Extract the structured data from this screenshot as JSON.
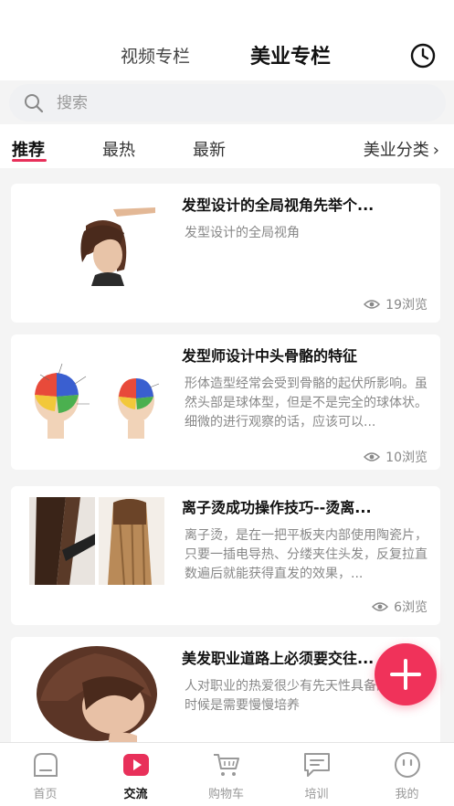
{
  "header": {
    "tab_video": "视频专栏",
    "tab_beauty": "美业专栏"
  },
  "search": {
    "placeholder": "搜索"
  },
  "filters": {
    "recommend": "推荐",
    "hot": "最热",
    "newest": "最新",
    "category": "美业分类"
  },
  "articles": [
    {
      "title": "发型设计的全局视角先举个...",
      "desc": "发型设计的全局视角",
      "views": "19浏览"
    },
    {
      "title": "发型师设计中头骨骼的特征",
      "desc": "形体造型经常会受到骨骼的起伏所影响。虽然头部是球体型，但是不是完全的球体状。细微的进行观察的话，应该可以...",
      "views": "10浏览"
    },
    {
      "title": "离子烫成功操作技巧--烫离...",
      "desc": "离子烫，是在一把平板夹内部使用陶瓷片，只要一插电导热、分缕夹住头发，反复拉直数遍后就能获得直发的效果，...",
      "views": "6浏览"
    },
    {
      "title": "美发职业道路上必须要交往...",
      "desc": "人对职业的热爱很少有先天性具备的，很多时候是需要慢慢培养",
      "views": ""
    }
  ],
  "tabbar": [
    {
      "label": "首页",
      "icon": "home-icon"
    },
    {
      "label": "交流",
      "icon": "play-icon"
    },
    {
      "label": "购物车",
      "icon": "cart-icon"
    },
    {
      "label": "培训",
      "icon": "chat-icon"
    },
    {
      "label": "我的",
      "icon": "face-icon"
    }
  ],
  "colors": {
    "accent": "#e8305a",
    "fab": "#f0325a",
    "background": "#f4f4f4"
  }
}
